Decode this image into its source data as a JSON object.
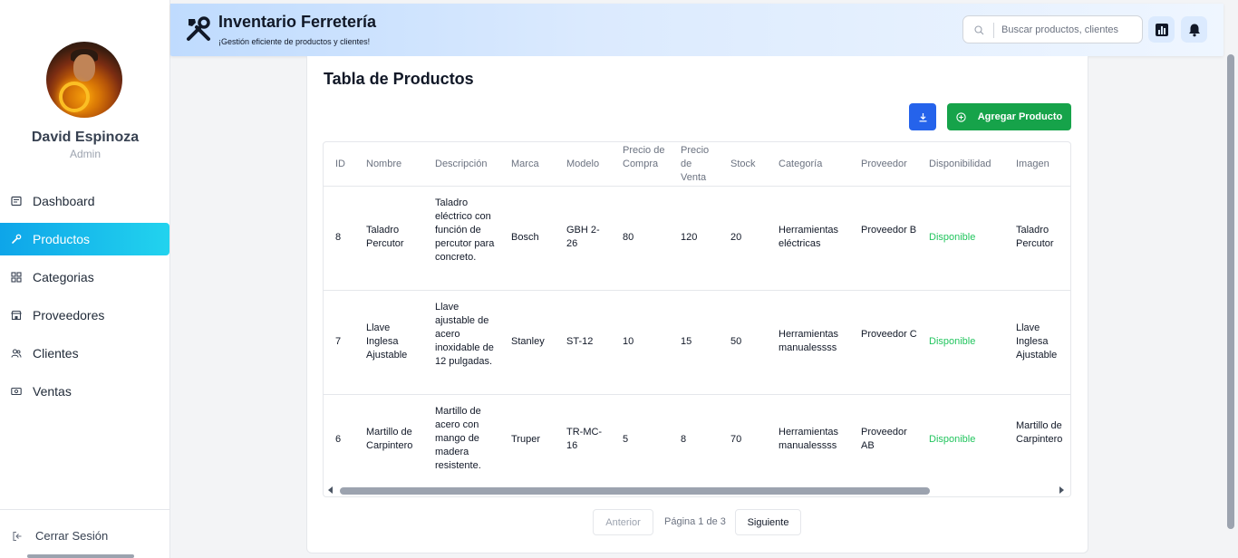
{
  "sidebar": {
    "user": {
      "name": "David Espinoza",
      "role": "Admin"
    },
    "items": [
      {
        "label": "Dashboard",
        "icon": "dashboard-icon"
      },
      {
        "label": "Productos",
        "icon": "wrench-icon",
        "active": true
      },
      {
        "label": "Categorias",
        "icon": "grid-icon"
      },
      {
        "label": "Proveedores",
        "icon": "store-icon"
      },
      {
        "label": "Clientes",
        "icon": "users-icon"
      },
      {
        "label": "Ventas",
        "icon": "cash-icon"
      }
    ],
    "logout": "Cerrar Sesión"
  },
  "header": {
    "title": "Inventario Ferretería",
    "subtitle": "¡Gestión eficiente de productos y clientes!",
    "search_placeholder": "Buscar productos, clientes"
  },
  "main": {
    "title": "Tabla de Productos",
    "add_button": "Agregar Producto",
    "table": {
      "headers": [
        "ID",
        "Nombre",
        "Descripción",
        "Marca",
        "Modelo",
        "Precio de Compra",
        "Precio de Venta",
        "Stock",
        "Categoría",
        "Proveedor",
        "Disponibilidad",
        "Imagen"
      ],
      "rows": [
        {
          "id": "8",
          "nombre": "Taladro Percutor",
          "descripcion": "Taladro eléctrico con función de percutor para concreto.",
          "marca": "Bosch",
          "modelo": "GBH 2-26",
          "compra": "80",
          "venta": "120",
          "stock": "20",
          "categoria": "Herramientas eléctricas",
          "proveedor": "Proveedor B",
          "disponibilidad": "Disponible",
          "imagen": "Taladro Percutor"
        },
        {
          "id": "7",
          "nombre": "Llave Inglesa Ajustable",
          "descripcion": "Llave ajustable de acero inoxidable de 12 pulgadas.",
          "marca": "Stanley",
          "modelo": "ST-12",
          "compra": "10",
          "venta": "15",
          "stock": "50",
          "categoria": "Herramientas manualessss",
          "proveedor": "Proveedor C",
          "disponibilidad": "Disponible",
          "imagen": "Llave Inglesa Ajustable"
        },
        {
          "id": "6",
          "nombre": "Martillo de Carpintero",
          "descripcion": "Martillo de acero con mango de madera resistente.",
          "marca": "Truper",
          "modelo": "TR-MC-16",
          "compra": "5",
          "venta": "8",
          "stock": "70",
          "categoria": "Herramientas manualessss",
          "proveedor": "Proveedor AB",
          "disponibilidad": "Disponible",
          "imagen": "Martillo de Carpintero"
        }
      ]
    },
    "pagination": {
      "prev": "Anterior",
      "info": "Página 1 de 3",
      "next": "Siguiente"
    }
  },
  "colors": {
    "accent": "#22d3ee",
    "primary": "#2563eb",
    "success": "#16a34a",
    "available": "#22c55e"
  }
}
